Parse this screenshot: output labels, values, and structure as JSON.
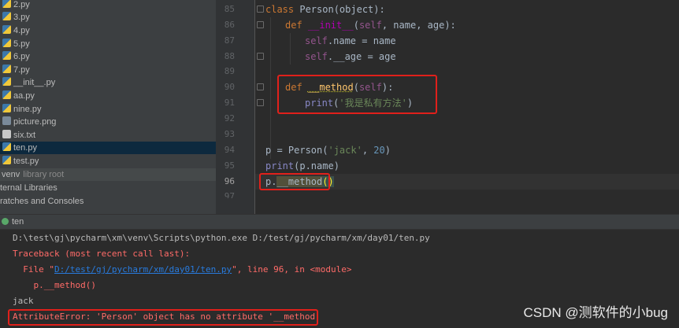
{
  "tree": {
    "items": [
      {
        "label": "2.py",
        "icon": "python-file-icon"
      },
      {
        "label": "3.py",
        "icon": "python-file-icon"
      },
      {
        "label": "4.py",
        "icon": "python-file-icon"
      },
      {
        "label": "5.py",
        "icon": "python-file-icon"
      },
      {
        "label": "6.py",
        "icon": "python-file-icon"
      },
      {
        "label": "7.py",
        "icon": "python-file-icon"
      },
      {
        "label": "__init__.py",
        "icon": "python-file-icon"
      },
      {
        "label": "aa.py",
        "icon": "python-file-icon"
      },
      {
        "label": "nine.py",
        "icon": "python-file-icon"
      },
      {
        "label": "picture.png",
        "icon": "image-file-icon"
      },
      {
        "label": "six.txt",
        "icon": "text-file-icon"
      },
      {
        "label": "ten.py",
        "icon": "python-file-icon"
      },
      {
        "label": "test.py",
        "icon": "python-file-icon"
      }
    ],
    "venv": {
      "label": "venv",
      "sub": "library root"
    },
    "external": "ternal Libraries",
    "scratches": "ratches and Consoles"
  },
  "editor": {
    "line_numbers": [
      "85",
      "86",
      "87",
      "88",
      "89",
      "90",
      "91",
      "92",
      "93",
      "94",
      "95",
      "96",
      "97"
    ],
    "code": {
      "l85_kw": "class ",
      "l85_rest": "Person(object):",
      "l86_kw": "def ",
      "l86_fn": "__init__",
      "l86_p1": "(",
      "l86_self": "self",
      "l86_rest": ", name, age):",
      "l87_self": "self",
      "l87_rest": ".name = name",
      "l88_self": "self",
      "l88_rest": ".__age = age",
      "l90_kw": "def ",
      "l90_fn": "__method",
      "l90_p1": "(",
      "l90_self": "self",
      "l90_rest": "):",
      "l91_builtin": "print",
      "l91_p1": "(",
      "l91_str": "'我是私有方法'",
      "l91_rest": ")",
      "l94_a": "p = Person(",
      "l94_str": "'jack'",
      "l94_b": ", ",
      "l94_num": "20",
      "l94_c": ")",
      "l95_builtin": "print",
      "l95_rest": "(p.name)",
      "l96_a": "p.",
      "l96_fn": "__method",
      "l96_paren": "()"
    }
  },
  "run": {
    "tab_label": "ten"
  },
  "console": {
    "cmd": "D:\\test\\gj\\pycharm\\xm\\venv\\Scripts\\python.exe D:/test/gj/pycharm/xm/day01/ten.py",
    "traceback": "Traceback (most recent call last):",
    "file_a": "  File \"",
    "file_link": "D:/test/gj/pycharm/xm/day01/ten.py",
    "file_b": "\", line 96, in <module>",
    "src": "    p.__method()",
    "out": "jack",
    "error": "AttributeError: 'Person' object has no attribute '__method'"
  },
  "watermark": "CSDN @测软件的小bug"
}
